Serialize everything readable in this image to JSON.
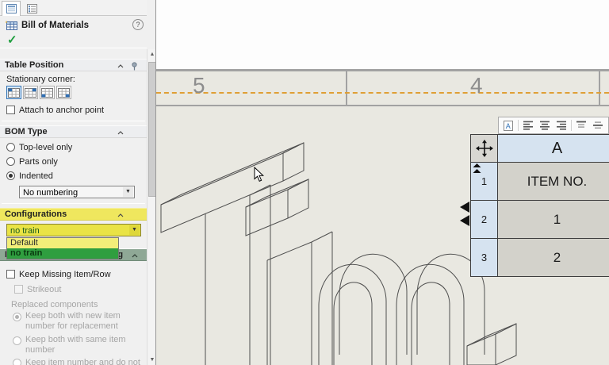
{
  "panel": {
    "title": "Bill of Materials",
    "help": "?",
    "ok_check": "✓",
    "table_position": {
      "header": "Table Position",
      "stationary_corner": "Stationary corner:",
      "attach_anchor": "Attach to anchor point"
    },
    "bom_type": {
      "header": "BOM Type",
      "top_level": "Top-level only",
      "parts_only": "Parts only",
      "indented": "Indented",
      "numbering": "No numbering"
    },
    "configurations": {
      "header": "Configurations",
      "value": "no train",
      "options": [
        "Default",
        "no train"
      ]
    },
    "part_config_grouping": {
      "header": "Part Configuration Grouping"
    },
    "missing_row": {
      "keep": "Keep Missing Item/Row",
      "strikeout": "Strikeout",
      "replaced": "Replaced components",
      "opt1": "Keep both with new item number for replacement",
      "opt2": "Keep both with same item number",
      "opt3": "Keep item number and do not"
    }
  },
  "drawing": {
    "zone_left": "5",
    "zone_right": "4"
  },
  "table": {
    "col": "A",
    "rows": [
      {
        "n": "1",
        "v": "ITEM NO."
      },
      {
        "n": "2",
        "v": "1"
      },
      {
        "n": "3",
        "v": "2"
      }
    ]
  },
  "colors": {
    "highlight_yellow": "#e9e345",
    "highlight_green": "#2f9e3f",
    "anchor_orange": "#df9f35",
    "ok_green": "#1e9e3e",
    "table_header_blue": "#d6e3f0"
  }
}
